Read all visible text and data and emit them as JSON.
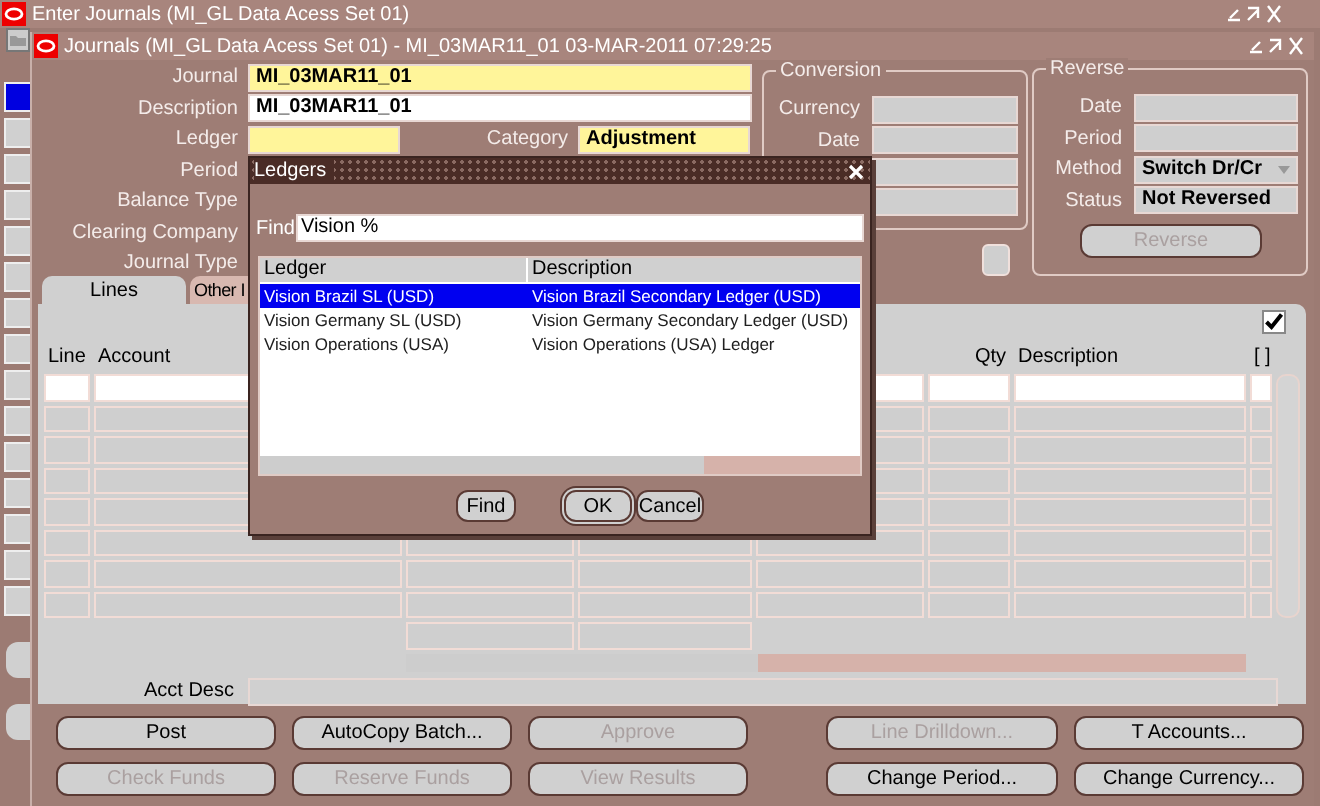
{
  "outer_window": {
    "title": "Enter Journals (MI_GL Data Acess Set 01)"
  },
  "side_strip": [
    {
      "selected": true
    },
    {
      "selected": false
    },
    {
      "selected": false
    },
    {
      "selected": false
    },
    {
      "selected": false
    },
    {
      "selected": false
    },
    {
      "selected": false
    },
    {
      "selected": false
    },
    {
      "selected": false
    },
    {
      "selected": false
    },
    {
      "selected": false
    },
    {
      "selected": false
    },
    {
      "selected": false
    },
    {
      "selected": false
    },
    {
      "selected": false
    }
  ],
  "window": {
    "title": "Journals (MI_GL Data Acess Set 01) - MI_03MAR11_01 03-MAR-2011 07:29:25"
  },
  "header": [
    {
      "label": "Journal",
      "kind": "field",
      "value": "MI_03MAR11_01",
      "required": true
    },
    {
      "label": "Description",
      "kind": "field",
      "value": "MI_03MAR11_01",
      "required": false
    },
    {
      "label": "Ledger",
      "kind": "pair",
      "required": true,
      "second_label": "Category",
      "second_value": "Adjustment"
    },
    {
      "label": "Period",
      "kind": "label"
    },
    {
      "label": "Balance Type",
      "kind": "label"
    },
    {
      "label": "Clearing Company",
      "kind": "label"
    },
    {
      "label": "Journal Type",
      "kind": "label"
    }
  ],
  "conversion": {
    "title": "Conversion",
    "fields": [
      {
        "kind": "labeled",
        "label": "Currency"
      },
      {
        "kind": "labeled",
        "label": "Date"
      },
      {
        "kind": "bare"
      },
      {
        "kind": "bare"
      }
    ]
  },
  "reverse": {
    "title": "Reverse",
    "fields": [
      {
        "kind": "labeled",
        "label": "Date"
      },
      {
        "kind": "labeled",
        "label": "Period"
      },
      {
        "kind": "dropdown",
        "label": "Method",
        "value": "Switch Dr/Cr"
      },
      {
        "kind": "labeled",
        "label": "Status",
        "value": "Not Reversed"
      }
    ],
    "button": {
      "label": "Reverse",
      "disabled": true
    }
  },
  "tabs": [
    {
      "label": "Lines",
      "selected": true
    },
    {
      "label": "Other I",
      "selected": false
    }
  ],
  "lines": {
    "checkbox": {
      "checked": true
    },
    "columns": [
      {
        "label": "Line"
      },
      {
        "label": "Account"
      },
      {
        "label": "Qty"
      },
      {
        "label": "Description"
      },
      {
        "label": "[ ]"
      }
    ],
    "rows": [
      {
        "selected": true
      },
      {
        "selected": false
      },
      {
        "selected": false
      },
      {
        "selected": false
      },
      {
        "selected": false
      },
      {
        "selected": false
      },
      {
        "selected": false
      },
      {
        "selected": false
      }
    ],
    "acct_desc_label": "Acct Desc"
  },
  "buttons": [
    [
      {
        "label": "Post",
        "disabled": false
      },
      {
        "label": "AutoCopy Batch...",
        "disabled": false
      },
      {
        "label": "Approve",
        "disabled": true
      },
      {
        "label": "Line Drilldown...",
        "disabled": true
      },
      {
        "label": "T Accounts...",
        "disabled": false
      }
    ],
    [
      {
        "label": "Check Funds",
        "disabled": true
      },
      {
        "label": "Reserve Funds",
        "disabled": true
      },
      {
        "label": "View Results",
        "disabled": true
      },
      {
        "label": "Change Period...",
        "disabled": false
      },
      {
        "label": "Change Currency...",
        "disabled": false
      }
    ]
  ],
  "dialog": {
    "title": "Ledgers",
    "find_label": "Find",
    "find_value": "Vision %",
    "columns": [
      "Ledger",
      "Description"
    ],
    "rows": [
      {
        "ledger": "Vision Brazil SL (USD)",
        "description": "Vision Brazil Secondary Ledger (USD)",
        "selected": true
      },
      {
        "ledger": "Vision Germany SL (USD)",
        "description": "Vision Germany Secondary Ledger (USD)",
        "selected": false
      },
      {
        "ledger": "Vision Operations (USA)",
        "description": "Vision Operations (USA) Ledger",
        "selected": false
      }
    ],
    "buttons": [
      {
        "label": "Find",
        "default": false
      },
      {
        "label": "OK",
        "default": true
      },
      {
        "label": "Cancel",
        "default": false
      }
    ]
  }
}
